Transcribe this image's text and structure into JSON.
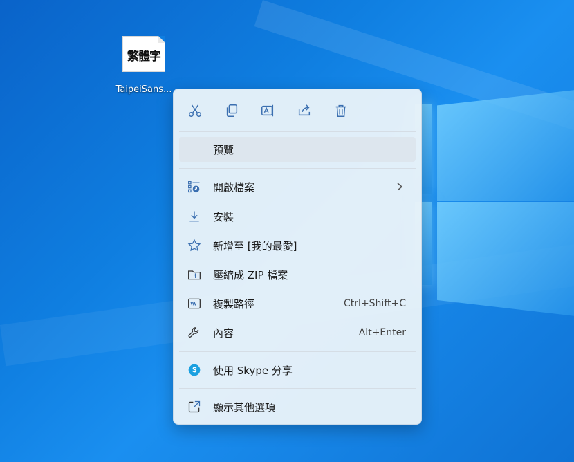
{
  "desktop": {
    "file": {
      "glyph": "繁體字",
      "label": "TaipeiSans..."
    }
  },
  "toolbar": [
    {
      "name": "cut-button",
      "icon": "scissors-icon"
    },
    {
      "name": "copy-button",
      "icon": "copy-icon"
    },
    {
      "name": "rename-button",
      "icon": "rename-icon"
    },
    {
      "name": "share-button",
      "icon": "share-icon"
    },
    {
      "name": "delete-button",
      "icon": "trash-icon"
    }
  ],
  "menu": {
    "preview": "預覽",
    "open_with": "開啟檔案",
    "install": "安裝",
    "add_favorites": "新增至 [我的最愛]",
    "compress_zip": "壓縮成 ZIP 檔案",
    "copy_path": "複製路徑",
    "copy_path_shortcut": "Ctrl+Shift+C",
    "properties": "內容",
    "properties_shortcut": "Alt+Enter",
    "share_skype": "使用 Skype 分享",
    "more_options": "顯示其他選項"
  },
  "colors": {
    "icon": "#3b6fb0",
    "menu_bg": "#e9f2f9",
    "highlight": "#dde6ee",
    "skype": "#1aa0e0"
  }
}
